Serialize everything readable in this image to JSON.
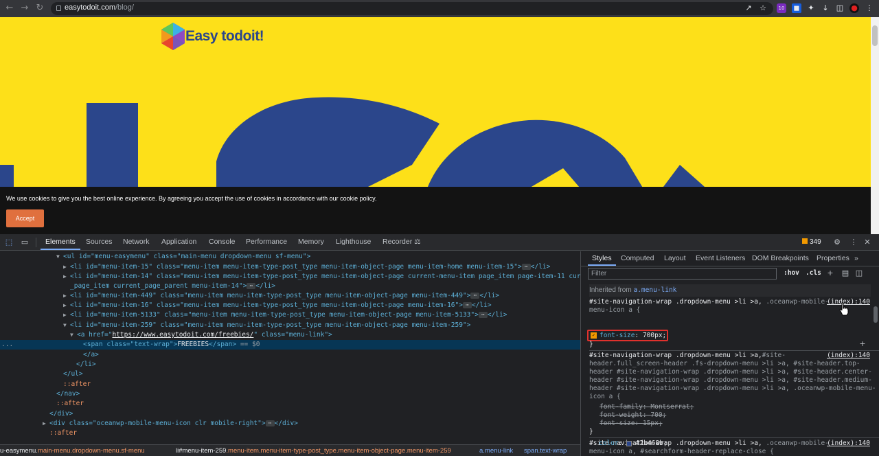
{
  "browser": {
    "url_host": "easytodoit.com",
    "url_path": "/blog/",
    "extension_badge": "10"
  },
  "page": {
    "logo_text": "Easy todoit!",
    "cookie_text": "We use cookies to give you the best online experience. By agreeing you accept the use of cookies in accordance with our cookie policy.",
    "accept_label": "Accept"
  },
  "devtools": {
    "tabs": [
      "Elements",
      "Sources",
      "Network",
      "Application",
      "Console",
      "Performance",
      "Memory",
      "Lighthouse",
      "Recorder"
    ],
    "active_tab": "Elements",
    "issues_count": "349",
    "styles_tabs": [
      "Styles",
      "Computed",
      "Layout",
      "Event Listeners",
      "DOM Breakpoints",
      "Properties"
    ],
    "filter_placeholder": "Filter",
    "hov_label": ":hov",
    "cls_label": ".cls",
    "inherited_label": "Inherited from",
    "inherited_selector": "a.menu-link",
    "source_link": "(index):140",
    "rule1_selector_a": "#site-navigation-wrap .dropdown-menu >li >a,",
    "rule1_selector_b": " .oceanwp-mobile-",
    "rule1_selector_c": "menu-icon a {",
    "rule1_prop": "font-size",
    "rule1_value": "700px;",
    "rule2_l1a": "#site-navigation-wrap .dropdown-menu >li >a,",
    "rule2_l1b": "#site-",
    "rule2_l2": "header.full_screen-header .fs-dropdown-menu >li >a, #site-header.top-",
    "rule2_l3": "header #site-navigation-wrap .dropdown-menu >li >a, #site-header.center-",
    "rule2_l4": "header #site-navigation-wrap .dropdown-menu >li >a, #site-header.medium-",
    "rule2_l5": "header #site-navigation-wrap .dropdown-menu >li >a, .oceanwp-mobile-menu-",
    "rule2_l6": "icon a {",
    "rule2_p1": "font-family",
    "rule2_v1": "Montserrat;",
    "rule2_p2": "font-weight",
    "rule2_v2": "700;",
    "rule2_p3": "font-size",
    "rule2_v3": "15px;",
    "rule3_l1a": "#site-navigation-wrap .dropdown-menu >li >a,",
    "rule3_l1b": " .oceanwp-mobile-",
    "rule3_l2": "menu-icon a, #searchform-header-replace-close {",
    "rule3_p1": "color",
    "rule3_v1": "#2b468b;",
    "color_swatch": "#2b468b",
    "breadcrumbs": {
      "c1_tag": "u-easymenu.",
      "c1_cls": "main-menu.dropdown-menu.sf-menu",
      "c2_tag": "li",
      "c2_id": "#menu-item-259",
      "c2_cls": ".menu-item.menu-item-type-post_type.menu-item-object-page.menu-item-259",
      "c3_tag": "a",
      "c3_cls": ".menu-link",
      "c4_tag": "span",
      "c4_cls": ".text-wrap"
    }
  },
  "dom": {
    "l0": "<ul id=\"menu-easymenu\" class=\"main-menu dropdown-menu sf-menu\">",
    "l1a": "<li id=\"menu-item-15\" class=\"menu-item menu-item-type-post_type menu-item-object-page menu-item-home menu-item-15\">",
    "l1b": "</li>",
    "l2": "<li id=\"menu-item-14\" class=\"menu-item menu-item-type-post_type menu-item-object-page current-menu-item page_item page-item-11 current",
    "l2b": "_page_item current_page_parent menu-item-14\">",
    "l3": "<li id=\"menu-item-449\" class=\"menu-item menu-item-type-post_type menu-item-object-page menu-item-449\">",
    "l4": "<li id=\"menu-item-16\" class=\"menu-item menu-item-type-post_type menu-item-object-page menu-item-16\">",
    "l5": "<li id=\"menu-item-5133\" class=\"menu-item menu-item-type-post_type menu-item-object-page menu-item-5133\">",
    "l6": "<li id=\"menu-item-259\" class=\"menu-item menu-item-type-post_type menu-item-object-page menu-item-259\">",
    "l7a": "<a href=\"",
    "l7href": "https://www.easytodoit.com/freebies/",
    "l7b": "\" class=\"menu-link\">",
    "l8a": "<span class=\"text-wrap\">",
    "l8txt": "FREEBIES",
    "l8b": "</span>",
    "l8c": " == $0",
    "l9": "</a>",
    "l10": "</li>",
    "l11": "</ul>",
    "l12": "::after",
    "l13": "</nav>",
    "l14": "::after",
    "l15": "</div>",
    "l16a": "<div class=\"oceanwp-mobile-menu-icon clr mobile-right\">",
    "l16b": "</div>",
    "l17": "::after",
    "sel_marker": "..."
  }
}
